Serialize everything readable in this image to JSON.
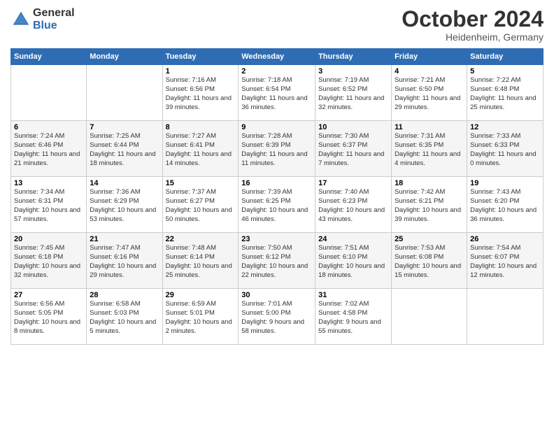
{
  "logo": {
    "general": "General",
    "blue": "Blue"
  },
  "title": "October 2024",
  "location": "Heidenheim, Germany",
  "headers": [
    "Sunday",
    "Monday",
    "Tuesday",
    "Wednesday",
    "Thursday",
    "Friday",
    "Saturday"
  ],
  "weeks": [
    [
      {
        "day": "",
        "info": ""
      },
      {
        "day": "",
        "info": ""
      },
      {
        "day": "1",
        "info": "Sunrise: 7:16 AM\nSunset: 6:56 PM\nDaylight: 11 hours and 39 minutes."
      },
      {
        "day": "2",
        "info": "Sunrise: 7:18 AM\nSunset: 6:54 PM\nDaylight: 11 hours and 36 minutes."
      },
      {
        "day": "3",
        "info": "Sunrise: 7:19 AM\nSunset: 6:52 PM\nDaylight: 11 hours and 32 minutes."
      },
      {
        "day": "4",
        "info": "Sunrise: 7:21 AM\nSunset: 6:50 PM\nDaylight: 11 hours and 29 minutes."
      },
      {
        "day": "5",
        "info": "Sunrise: 7:22 AM\nSunset: 6:48 PM\nDaylight: 11 hours and 25 minutes."
      }
    ],
    [
      {
        "day": "6",
        "info": "Sunrise: 7:24 AM\nSunset: 6:46 PM\nDaylight: 11 hours and 21 minutes."
      },
      {
        "day": "7",
        "info": "Sunrise: 7:25 AM\nSunset: 6:44 PM\nDaylight: 11 hours and 18 minutes."
      },
      {
        "day": "8",
        "info": "Sunrise: 7:27 AM\nSunset: 6:41 PM\nDaylight: 11 hours and 14 minutes."
      },
      {
        "day": "9",
        "info": "Sunrise: 7:28 AM\nSunset: 6:39 PM\nDaylight: 11 hours and 11 minutes."
      },
      {
        "day": "10",
        "info": "Sunrise: 7:30 AM\nSunset: 6:37 PM\nDaylight: 11 hours and 7 minutes."
      },
      {
        "day": "11",
        "info": "Sunrise: 7:31 AM\nSunset: 6:35 PM\nDaylight: 11 hours and 4 minutes."
      },
      {
        "day": "12",
        "info": "Sunrise: 7:33 AM\nSunset: 6:33 PM\nDaylight: 11 hours and 0 minutes."
      }
    ],
    [
      {
        "day": "13",
        "info": "Sunrise: 7:34 AM\nSunset: 6:31 PM\nDaylight: 10 hours and 57 minutes."
      },
      {
        "day": "14",
        "info": "Sunrise: 7:36 AM\nSunset: 6:29 PM\nDaylight: 10 hours and 53 minutes."
      },
      {
        "day": "15",
        "info": "Sunrise: 7:37 AM\nSunset: 6:27 PM\nDaylight: 10 hours and 50 minutes."
      },
      {
        "day": "16",
        "info": "Sunrise: 7:39 AM\nSunset: 6:25 PM\nDaylight: 10 hours and 46 minutes."
      },
      {
        "day": "17",
        "info": "Sunrise: 7:40 AM\nSunset: 6:23 PM\nDaylight: 10 hours and 43 minutes."
      },
      {
        "day": "18",
        "info": "Sunrise: 7:42 AM\nSunset: 6:21 PM\nDaylight: 10 hours and 39 minutes."
      },
      {
        "day": "19",
        "info": "Sunrise: 7:43 AM\nSunset: 6:20 PM\nDaylight: 10 hours and 36 minutes."
      }
    ],
    [
      {
        "day": "20",
        "info": "Sunrise: 7:45 AM\nSunset: 6:18 PM\nDaylight: 10 hours and 32 minutes."
      },
      {
        "day": "21",
        "info": "Sunrise: 7:47 AM\nSunset: 6:16 PM\nDaylight: 10 hours and 29 minutes."
      },
      {
        "day": "22",
        "info": "Sunrise: 7:48 AM\nSunset: 6:14 PM\nDaylight: 10 hours and 25 minutes."
      },
      {
        "day": "23",
        "info": "Sunrise: 7:50 AM\nSunset: 6:12 PM\nDaylight: 10 hours and 22 minutes."
      },
      {
        "day": "24",
        "info": "Sunrise: 7:51 AM\nSunset: 6:10 PM\nDaylight: 10 hours and 18 minutes."
      },
      {
        "day": "25",
        "info": "Sunrise: 7:53 AM\nSunset: 6:08 PM\nDaylight: 10 hours and 15 minutes."
      },
      {
        "day": "26",
        "info": "Sunrise: 7:54 AM\nSunset: 6:07 PM\nDaylight: 10 hours and 12 minutes."
      }
    ],
    [
      {
        "day": "27",
        "info": "Sunrise: 6:56 AM\nSunset: 5:05 PM\nDaylight: 10 hours and 8 minutes."
      },
      {
        "day": "28",
        "info": "Sunrise: 6:58 AM\nSunset: 5:03 PM\nDaylight: 10 hours and 5 minutes."
      },
      {
        "day": "29",
        "info": "Sunrise: 6:59 AM\nSunset: 5:01 PM\nDaylight: 10 hours and 2 minutes."
      },
      {
        "day": "30",
        "info": "Sunrise: 7:01 AM\nSunset: 5:00 PM\nDaylight: 9 hours and 58 minutes."
      },
      {
        "day": "31",
        "info": "Sunrise: 7:02 AM\nSunset: 4:58 PM\nDaylight: 9 hours and 55 minutes."
      },
      {
        "day": "",
        "info": ""
      },
      {
        "day": "",
        "info": ""
      }
    ]
  ]
}
